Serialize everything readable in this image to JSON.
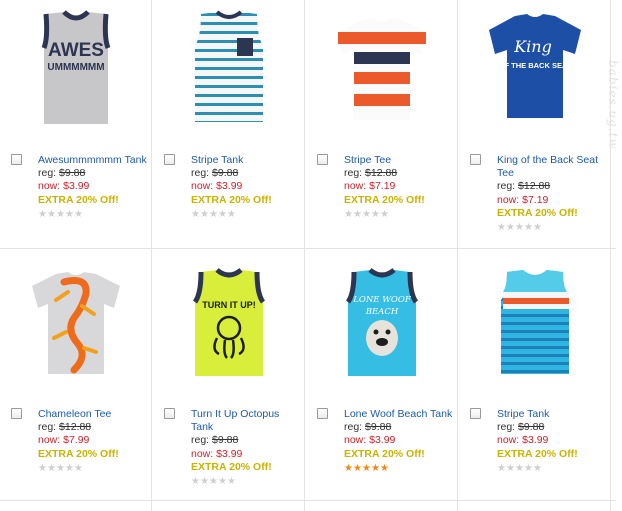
{
  "products": [
    {
      "name": "Awesummmmmm Tank",
      "reg_label": "reg:",
      "reg_price": "$9.88",
      "now_label": "now:",
      "now_price": "$3.99",
      "promo": "EXTRA 20% Off!",
      "rating": 0,
      "image_icon": "gray-tank-awes-graphic",
      "image_text": "AWES",
      "image_subtext": "UMMMMMM"
    },
    {
      "name": "Stripe Tank",
      "reg_label": "reg:",
      "reg_price": "$9.88",
      "now_label": "now:",
      "now_price": "$3.99",
      "promo": "EXTRA 20% Off!",
      "rating": 0,
      "image_icon": "white-blue-striped-tank"
    },
    {
      "name": "Stripe Tee",
      "reg_label": "reg:",
      "reg_price": "$12.88",
      "now_label": "now:",
      "now_price": "$7.19",
      "promo": "EXTRA 20% Off!",
      "rating": 0,
      "image_icon": "orange-navy-striped-tee"
    },
    {
      "name": "King of the Back Seat Tee",
      "reg_label": "reg:",
      "reg_price": "$12.88",
      "now_label": "now:",
      "now_price": "$7.19",
      "promo": "EXTRA 20% Off!",
      "rating": 0,
      "image_icon": "blue-tee-king-graphic",
      "image_text": "King",
      "image_subtext": "OF THE BACK SEAT"
    },
    {
      "name": "Chameleon Tee",
      "reg_label": "reg:",
      "reg_price": "$12.88",
      "now_label": "now:",
      "now_price": "$7.99",
      "promo": "EXTRA 20% Off!",
      "rating": 0,
      "image_icon": "gray-tee-chameleon-graphic"
    },
    {
      "name": "Turn It Up Octopus Tank",
      "reg_label": "reg:",
      "reg_price": "$9.88",
      "now_label": "now:",
      "now_price": "$3.99",
      "promo": "EXTRA 20% Off!",
      "rating": 0,
      "image_icon": "lime-tank-octopus-graphic",
      "image_text": "TURN IT UP!"
    },
    {
      "name": "Lone Woof Beach Tank",
      "reg_label": "reg:",
      "reg_price": "$9.88",
      "now_label": "now:",
      "now_price": "$3.99",
      "promo": "EXTRA 20% Off!",
      "rating": 5,
      "image_icon": "aqua-tank-bulldog-graphic",
      "image_text": "LONE WOOF",
      "image_subtext": "BEACH"
    },
    {
      "name": "Stripe Tank",
      "reg_label": "reg:",
      "reg_price": "$9.88",
      "now_label": "now:",
      "now_price": "$3.99",
      "promo": "EXTRA 20% Off!",
      "rating": 0,
      "image_icon": "aqua-striped-tank"
    }
  ],
  "colors": {
    "link": "#1d5aa8",
    "now_price": "#d2202a",
    "promo": "#c9b300",
    "star_on": "#f08a16",
    "star_off": "#cfcfcf"
  },
  "watermark": "babies.ug.tw"
}
